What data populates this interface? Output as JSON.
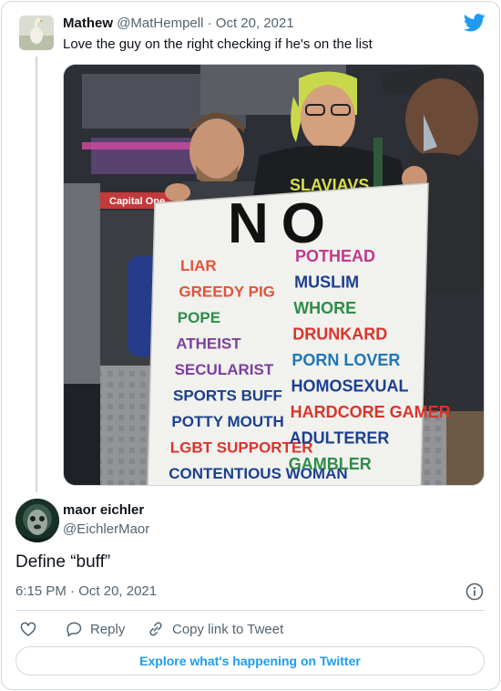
{
  "parent_tweet": {
    "name": "Mathew",
    "handle": "@MatHempell",
    "separator": "·",
    "date": "Oct 20, 2021",
    "text": "Love the guy on the right checking if he's on the list"
  },
  "sign": {
    "heading": "NO",
    "left_column": [
      {
        "text": "LIAR",
        "color": "#e0533a"
      },
      {
        "text": "GREEDY PIG",
        "color": "#e0533a"
      },
      {
        "text": "POPE",
        "color": "#2f8c48"
      },
      {
        "text": "ATHEIST",
        "color": "#7b3f9c"
      },
      {
        "text": "SECULARIST",
        "color": "#7b3f9c"
      },
      {
        "text": "SPORTS BUFF",
        "color": "#1c3f8f"
      },
      {
        "text": "POTTY MOUTH",
        "color": "#1c3f8f"
      },
      {
        "text": "LGBT SUPPORTER",
        "color": "#d9352c"
      },
      {
        "text": "CONTENTIOUS WOMAN",
        "color": "#1c3f8f"
      }
    ],
    "right_column": [
      {
        "text": "POTHEAD",
        "color": "#c03a8c"
      },
      {
        "text": "MUSLIM",
        "color": "#1c3f8f"
      },
      {
        "text": "WHORE",
        "color": "#2f8c48"
      },
      {
        "text": "DRUNKARD",
        "color": "#d9352c"
      },
      {
        "text": "PORN LOVER",
        "color": "#1e77b5"
      },
      {
        "text": "HOMOSEXUAL",
        "color": "#1c3f8f"
      },
      {
        "text": "HARDCORE GAMER",
        "color": "#d9352c"
      },
      {
        "text": "ADULTERER",
        "color": "#1c3f8f"
      },
      {
        "text": "GAMBLER",
        "color": "#2f8c48"
      }
    ],
    "hat_text": "SLAVIAVS",
    "store_sign": "Capital One"
  },
  "main_tweet": {
    "name": "maor eichler",
    "handle": "@EichlerMaor",
    "text": "Define “buff”",
    "time": "6:15 PM",
    "separator": "·",
    "date": "Oct 20, 2021"
  },
  "actions": {
    "like_label": "",
    "reply_label": "Reply",
    "copy_label": "Copy link to Tweet"
  },
  "explore_label": "Explore what's happening on Twitter",
  "colors": {
    "twitter_blue": "#1d9bf0",
    "text_primary": "#0f1419",
    "text_secondary": "#536471",
    "border": "#cfd9de"
  },
  "icons": [
    "twitter-bird-icon",
    "info-icon",
    "heart-icon",
    "reply-icon",
    "link-icon"
  ]
}
